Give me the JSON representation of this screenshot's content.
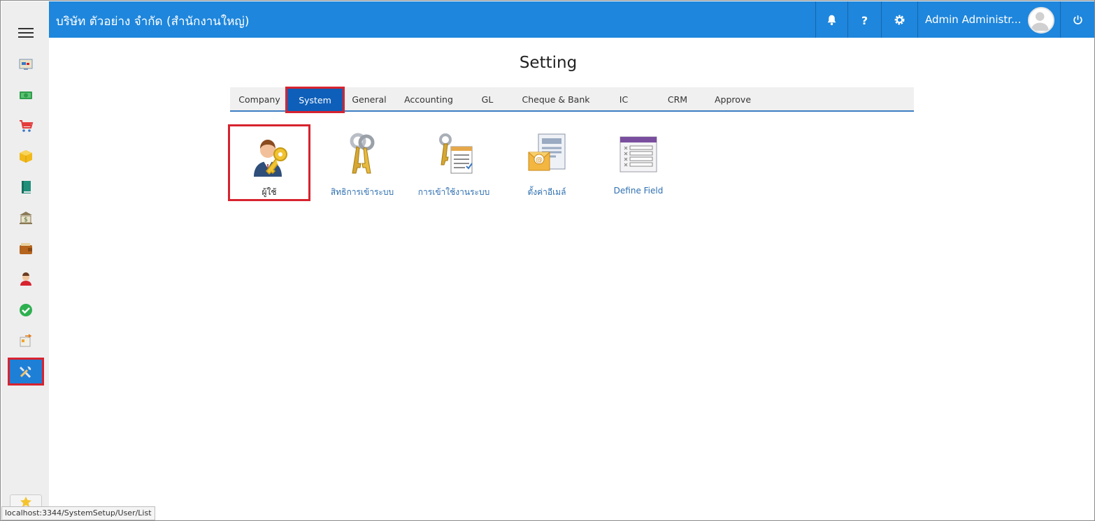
{
  "header": {
    "company": "บริษัท ตัวอย่าง จำกัด (สำนักงานใหญ่)",
    "user": "Admin Administr...",
    "icons": [
      "bell-icon",
      "help-icon",
      "gear-icon",
      "power-icon"
    ]
  },
  "sidebar": {
    "items": [
      {
        "name": "dashboard-icon"
      },
      {
        "name": "money-icon"
      },
      {
        "name": "cart-icon"
      },
      {
        "name": "box-icon"
      },
      {
        "name": "book-icon"
      },
      {
        "name": "bank-icon"
      },
      {
        "name": "wallet-icon"
      },
      {
        "name": "person-icon"
      },
      {
        "name": "check-icon"
      },
      {
        "name": "transfer-icon"
      },
      {
        "name": "tools-icon",
        "active": true
      }
    ]
  },
  "page": {
    "title": "Setting"
  },
  "tabs": [
    {
      "label": "Company"
    },
    {
      "label": "System",
      "active": true
    },
    {
      "label": "General"
    },
    {
      "label": "Accounting"
    },
    {
      "label": "GL"
    },
    {
      "label": "Cheque & Bank"
    },
    {
      "label": "IC"
    },
    {
      "label": "CRM"
    },
    {
      "label": "Approve"
    }
  ],
  "tiles": [
    {
      "label": "ผู้ใช้",
      "icon": "user-key-icon",
      "active": true
    },
    {
      "label": "สิทธิการเข้าระบบ",
      "icon": "keys-icon"
    },
    {
      "label": "การเข้าใช้งานระบบ",
      "icon": "key-document-icon"
    },
    {
      "label": "ตั้งค่าอีเมล์",
      "icon": "email-settings-icon"
    },
    {
      "label": "Define Field",
      "icon": "define-field-icon"
    }
  ],
  "status_bar": {
    "url": "localhost:3344/SystemSetup/User/List"
  },
  "colors": {
    "header": "#1e86dc",
    "active_tab": "#0e5fb9",
    "highlight": "#d7232f"
  }
}
